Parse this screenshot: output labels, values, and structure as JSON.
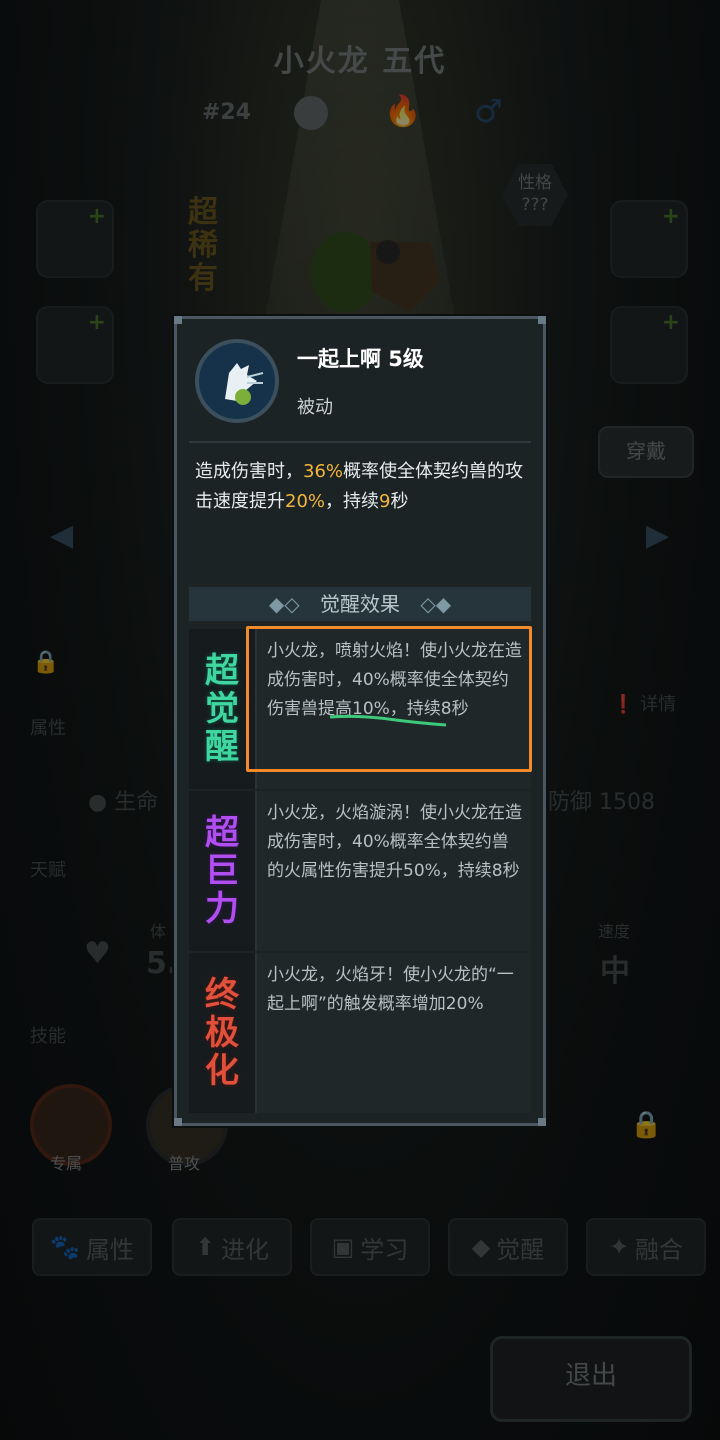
{
  "header": {
    "title": "小火龙 五代",
    "number": "#24"
  },
  "rarity_label": "超稀有",
  "nature": {
    "label": "性格",
    "value": "???"
  },
  "wear_button": "穿戴",
  "background": {
    "attr_label": "属性",
    "detail_label": "详情",
    "hp_label": "生命",
    "defense_label": "防御",
    "defense_value": "1508",
    "talent_label": "天赋",
    "physique_label": "体",
    "physique_value": "5.",
    "speed_label": "速度",
    "speed_value": "中",
    "skills_label": "技能",
    "exclusive_label": "专属",
    "normal_attack_label": "普攻"
  },
  "tabs": [
    {
      "label": "属性",
      "icon": "paw-icon"
    },
    {
      "label": "进化",
      "icon": "evolve-icon"
    },
    {
      "label": "学习",
      "icon": "book-icon"
    },
    {
      "label": "觉醒",
      "icon": "wolf-icon"
    },
    {
      "label": "融合",
      "icon": "fusion-icon"
    }
  ],
  "exit_button": "退出",
  "popup": {
    "skill_name": "一起上啊 5级",
    "skill_type": "被动",
    "desc_parts": [
      "造成伤害时，",
      "36%",
      "概率使全体契约兽的攻击速度提升",
      "20%",
      "，持续",
      "9",
      "秒"
    ],
    "awaken_header": "觉醒效果",
    "awakenings": [
      {
        "badge": "超觉醒",
        "badge_color": "#3fd6a0",
        "text": "小火龙，喷射火焰！使小火龙在造成伤害时，40%概率使全体契约伤害兽提高10%，持续8秒"
      },
      {
        "badge": "超巨力",
        "badge_color": "#b14ef0",
        "text": "小火龙，火焰漩涡！使小火龙在造成伤害时，40%概率全体契约兽的火属性伤害提升50%，持续8秒"
      },
      {
        "badge": "终极化",
        "badge_color": "#e0503a",
        "text": "小火龙，火焰牙！使小火龙的“一起上啊”的触发概率增加20%"
      }
    ]
  },
  "colors": {
    "highlight": "#f2b73a",
    "annotation_box": "#f28a2a",
    "annotation_line": "#3cc97a"
  }
}
